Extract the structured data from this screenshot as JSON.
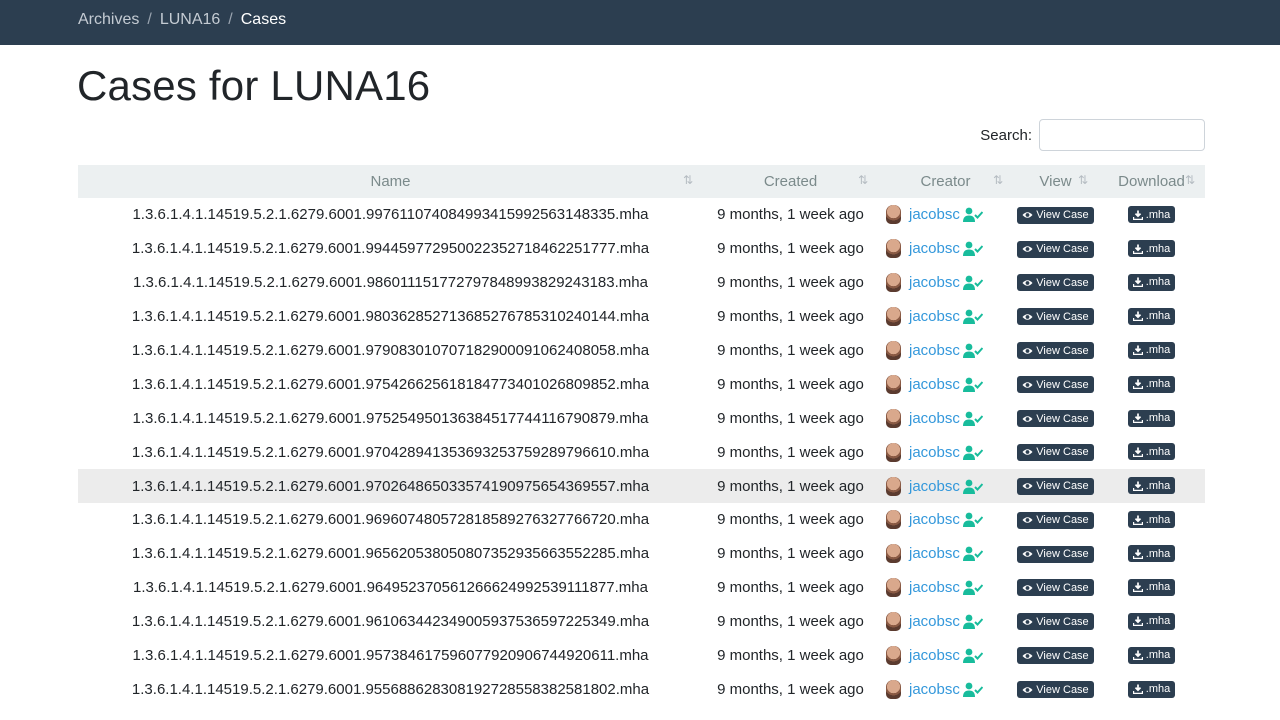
{
  "breadcrumb": {
    "items": [
      "Archives",
      "LUNA16"
    ],
    "current": "Cases",
    "separator": "/"
  },
  "page": {
    "title": "Cases for LUNA16"
  },
  "search": {
    "label": "Search:",
    "value": "",
    "placeholder": ""
  },
  "table": {
    "columns": [
      "Name",
      "Created",
      "Creator",
      "View",
      "Download"
    ],
    "sort_icon": "⇅",
    "view_button_label": "View Case",
    "download_button_label": ".mha",
    "icons": {
      "avatar": "user-avatar",
      "verified": "user-check-icon",
      "view": "eye-icon",
      "download": "download-icon"
    },
    "rows": [
      {
        "name": "1.3.6.1.4.1.14519.5.2.1.6279.6001.997611074084993415992563148335.mha",
        "created": "9 months, 1 week ago",
        "creator": "jacobsc"
      },
      {
        "name": "1.3.6.1.4.1.14519.5.2.1.6279.6001.994459772950022352718462251777.mha",
        "created": "9 months, 1 week ago",
        "creator": "jacobsc"
      },
      {
        "name": "1.3.6.1.4.1.14519.5.2.1.6279.6001.986011151772797848993829243183.mha",
        "created": "9 months, 1 week ago",
        "creator": "jacobsc"
      },
      {
        "name": "1.3.6.1.4.1.14519.5.2.1.6279.6001.980362852713685276785310240144.mha",
        "created": "9 months, 1 week ago",
        "creator": "jacobsc"
      },
      {
        "name": "1.3.6.1.4.1.14519.5.2.1.6279.6001.979083010707182900091062408058.mha",
        "created": "9 months, 1 week ago",
        "creator": "jacobsc"
      },
      {
        "name": "1.3.6.1.4.1.14519.5.2.1.6279.6001.975426625618184773401026809852.mha",
        "created": "9 months, 1 week ago",
        "creator": "jacobsc"
      },
      {
        "name": "1.3.6.1.4.1.14519.5.2.1.6279.6001.975254950136384517744116790879.mha",
        "created": "9 months, 1 week ago",
        "creator": "jacobsc"
      },
      {
        "name": "1.3.6.1.4.1.14519.5.2.1.6279.6001.970428941353693253759289796610.mha",
        "created": "9 months, 1 week ago",
        "creator": "jacobsc"
      },
      {
        "name": "1.3.6.1.4.1.14519.5.2.1.6279.6001.970264865033574190975654369557.mha",
        "created": "9 months, 1 week ago",
        "creator": "jacobsc"
      },
      {
        "name": "1.3.6.1.4.1.14519.5.2.1.6279.6001.969607480572818589276327766720.mha",
        "created": "9 months, 1 week ago",
        "creator": "jacobsc"
      },
      {
        "name": "1.3.6.1.4.1.14519.5.2.1.6279.6001.965620538050807352935663552285.mha",
        "created": "9 months, 1 week ago",
        "creator": "jacobsc"
      },
      {
        "name": "1.3.6.1.4.1.14519.5.2.1.6279.6001.964952370561266624992539111877.mha",
        "created": "9 months, 1 week ago",
        "creator": "jacobsc"
      },
      {
        "name": "1.3.6.1.4.1.14519.5.2.1.6279.6001.961063442349005937536597225349.mha",
        "created": "9 months, 1 week ago",
        "creator": "jacobsc"
      },
      {
        "name": "1.3.6.1.4.1.14519.5.2.1.6279.6001.957384617596077920906744920611.mha",
        "created": "9 months, 1 week ago",
        "creator": "jacobsc"
      },
      {
        "name": "1.3.6.1.4.1.14519.5.2.1.6279.6001.955688628308192728558382581802.mha",
        "created": "9 months, 1 week ago",
        "creator": "jacobsc"
      }
    ]
  },
  "colors": {
    "navbar": "#2c3e50",
    "link": "#3498db",
    "verified": "#18bc9c",
    "button": "#2c3e50",
    "header_bg": "#ecf0f1"
  }
}
